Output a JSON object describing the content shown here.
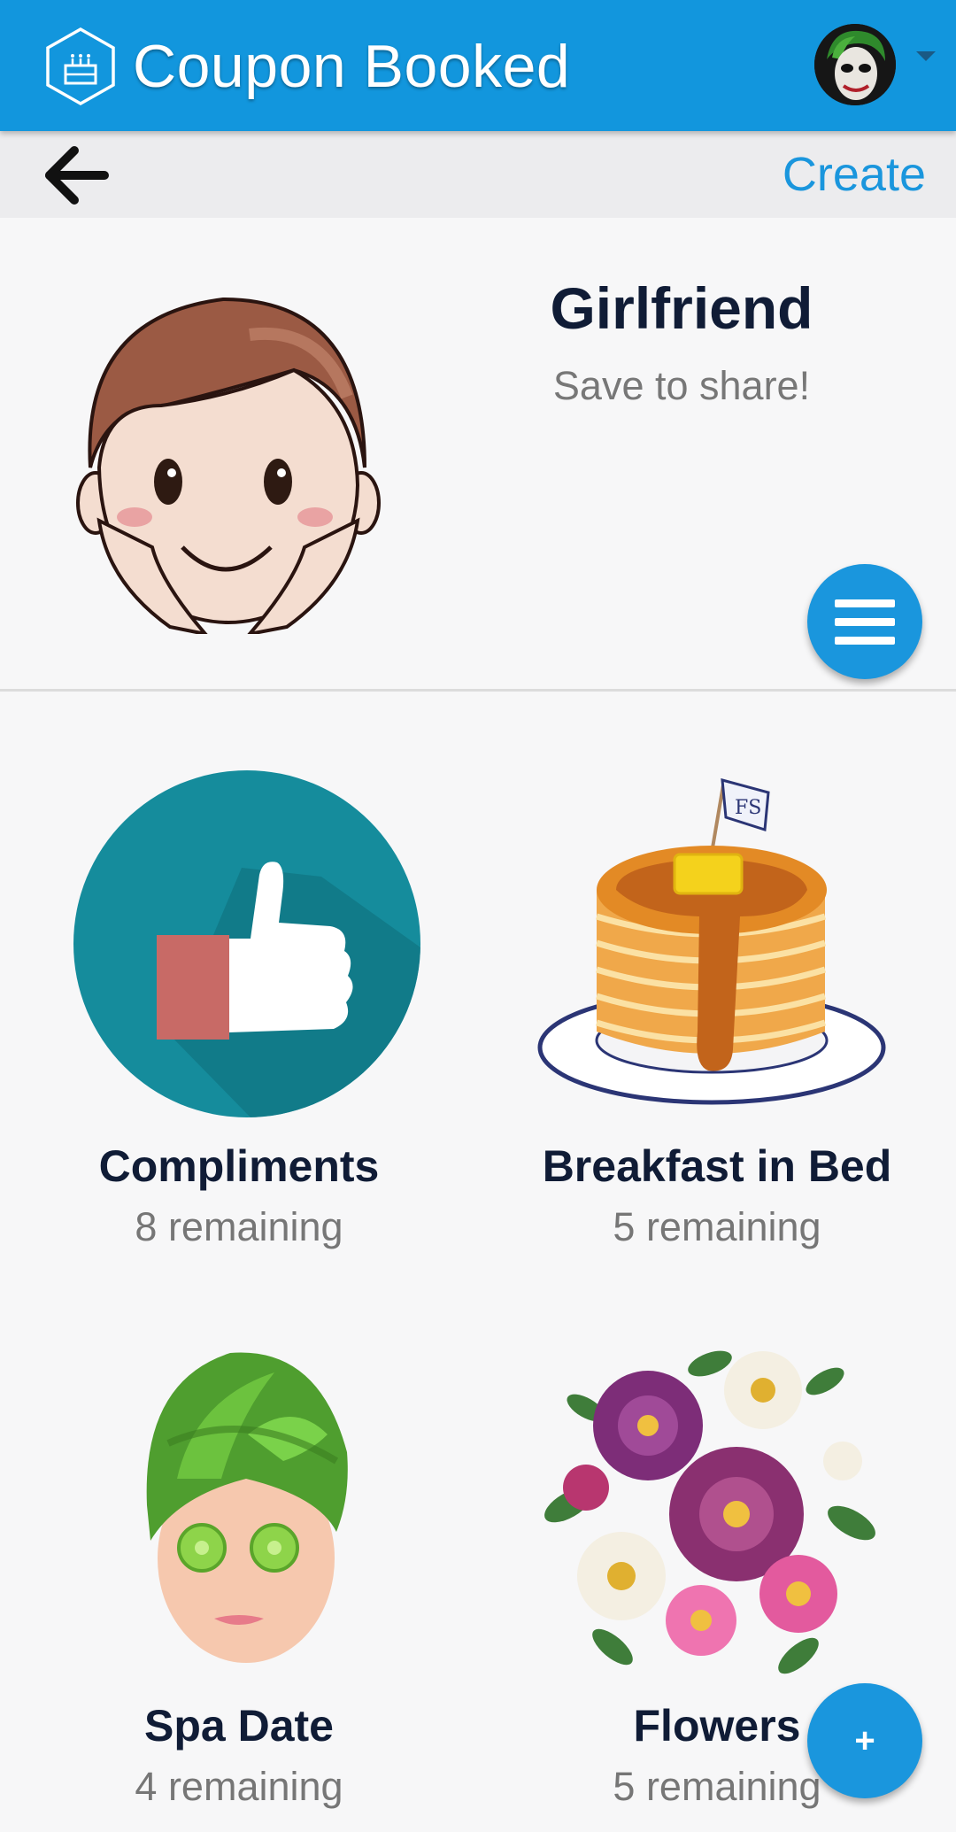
{
  "app": {
    "title": "Coupon Booked"
  },
  "toolbar": {
    "create_label": "Create"
  },
  "profile": {
    "name": "Girlfriend",
    "subtitle": "Save to share!"
  },
  "coupons": [
    {
      "title": "Compliments",
      "remaining": "8 remaining"
    },
    {
      "title": "Breakfast in Bed",
      "remaining": "5 remaining"
    },
    {
      "title": "Spa Date",
      "remaining": "4 remaining"
    },
    {
      "title": "Flowers",
      "remaining": "5 remaining"
    }
  ],
  "fab": {
    "add_label": "+"
  },
  "colors": {
    "primary": "#1296dd",
    "heading": "#101c36",
    "muted": "#767676"
  }
}
